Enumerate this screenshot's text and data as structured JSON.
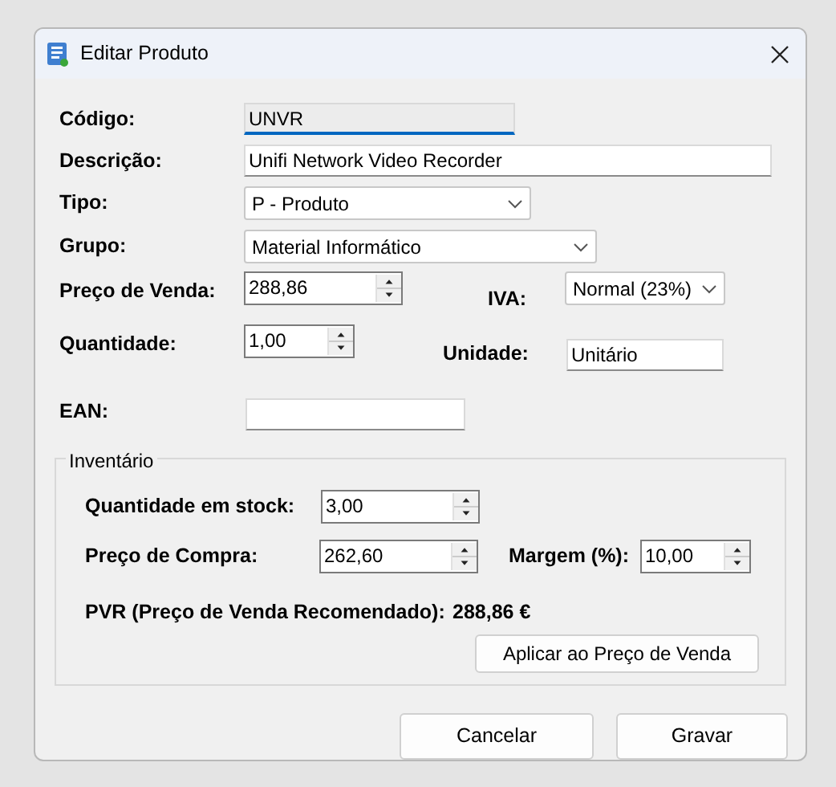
{
  "window": {
    "title": "Editar Produto"
  },
  "fields": [
    {
      "label": "Código:",
      "kind": "text",
      "value": "UNVR",
      "focused": true
    },
    {
      "label": "Descrição:",
      "kind": "text",
      "value": "Unifi Network Video Recorder",
      "focused": false
    },
    {
      "label": "Tipo:",
      "kind": "combo",
      "value": "P - Produto"
    },
    {
      "label": "Grupo:",
      "kind": "combo",
      "value": "Material Informático"
    },
    {
      "label": "Preço de Venda:",
      "kind": "spin",
      "value": "288,86"
    },
    {
      "label": "IVA:",
      "kind": "combo",
      "value": "Normal (23%)"
    },
    {
      "label": "Quantidade:",
      "kind": "spin",
      "value": "1,00"
    },
    {
      "label": "Unidade:",
      "kind": "text",
      "value": "Unitário",
      "focused": false
    },
    {
      "label": "EAN:",
      "kind": "text",
      "focused": false
    }
  ],
  "inventory": {
    "title": "Inventário",
    "fields": [
      {
        "label": "Quantidade em stock:",
        "kind": "spin",
        "value": "3,00"
      },
      {
        "label": "Preço de Compra:",
        "kind": "spin",
        "value": "262,60"
      },
      {
        "label": "Margem (%):",
        "kind": "spin",
        "value": "10,00"
      }
    ],
    "pvr_label": "PVR (Preço de Venda Recomendado):",
    "pvr_value": "288,86 €",
    "apply_button": "Aplicar ao Preço de Venda"
  },
  "buttons": [
    "Cancelar",
    "Gravar"
  ]
}
